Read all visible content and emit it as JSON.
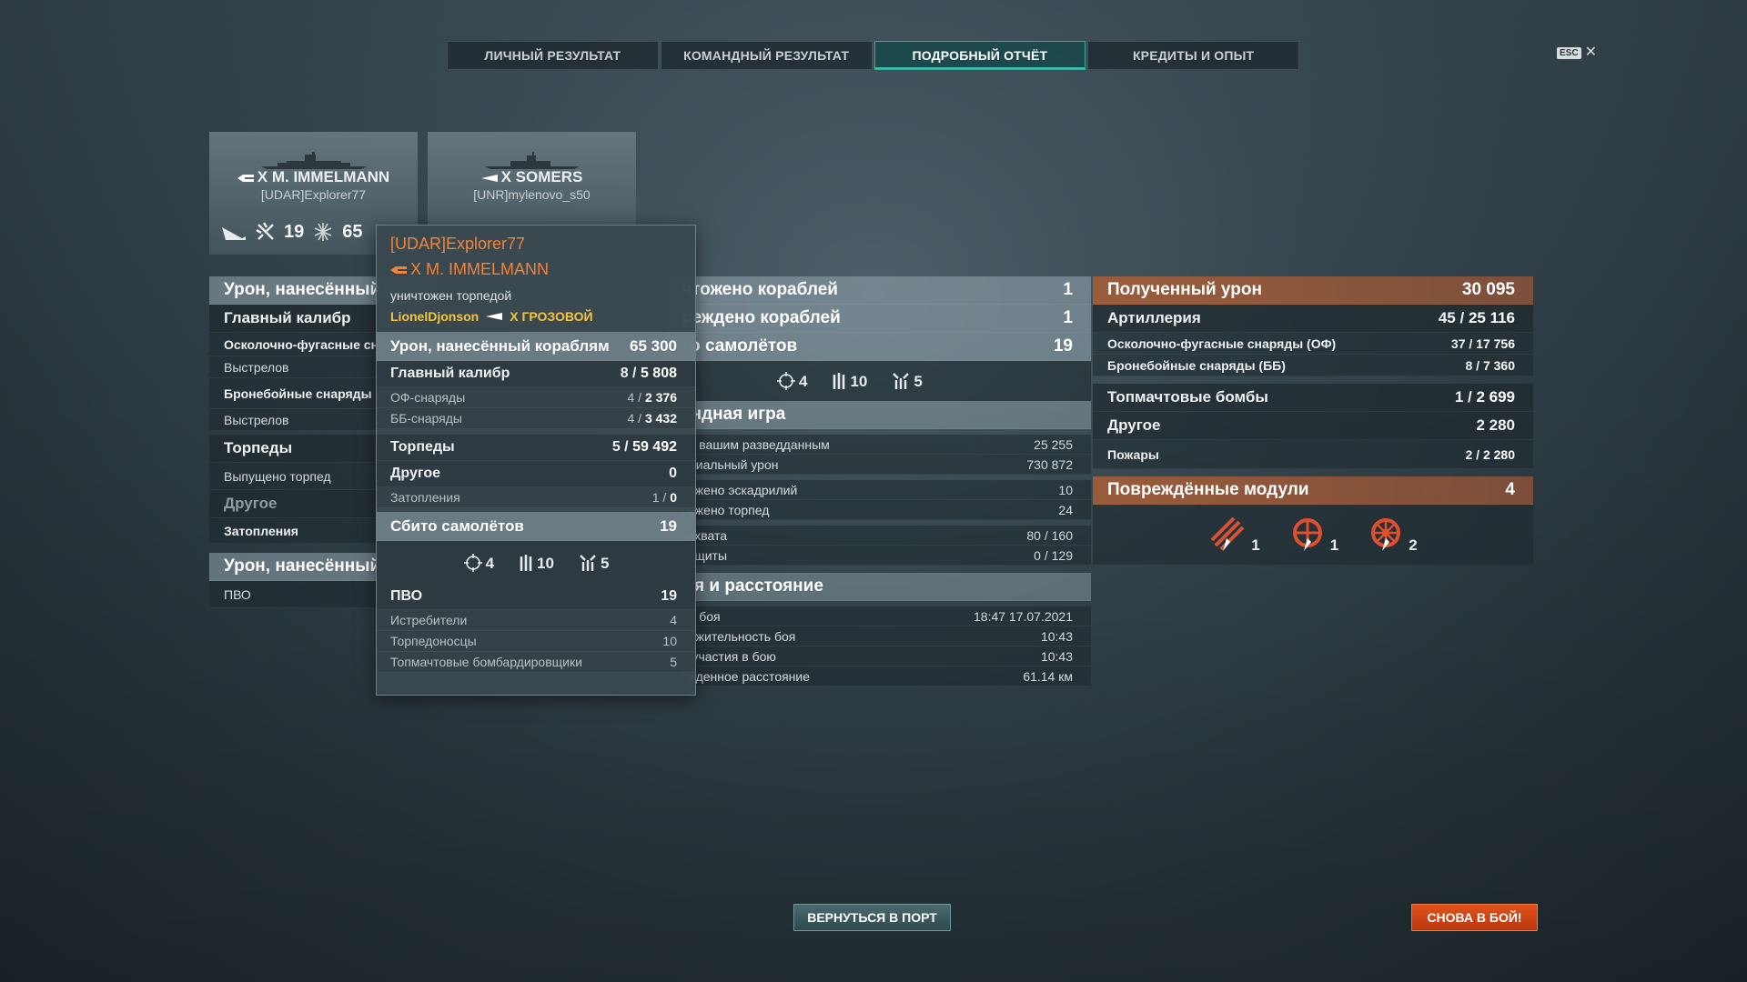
{
  "tabs": [
    "ЛИЧНЫЙ РЕЗУЛЬТАТ",
    "КОМАНДНЫЙ РЕЗУЛЬТАТ",
    "ПОДРОБНЫЙ ОТЧЁТ",
    "КРЕДИТЫ И ОПЫТ"
  ],
  "active_tab": "ПОДРОБНЫЙ ОТЧЁТ",
  "esc": {
    "key": "ESC",
    "close": "✕"
  },
  "cards": [
    {
      "ship": "X M. IMMELMANN",
      "player": "[UDAR]Explorer77",
      "planes": "19",
      "hits": "65"
    },
    {
      "ship": "X SOMERS",
      "player": "[UNR]mylenovo_s50"
    }
  ],
  "left": {
    "header": "Урон, нанесённый",
    "main_caliber": "Главный калибр",
    "he": "Осколочно-фугасные сна",
    "shots1": "Выстрелов",
    "ap": "Бронебойные снаряды (Б",
    "shots2": "Выстрелов",
    "torpedoes": "Торпеды",
    "torp_launched": "Выпущено торпед",
    "other": "Другое",
    "flooding": "Затопления",
    "header2": "Урон, нанесённый",
    "aa": "ПВО"
  },
  "middle": {
    "destroyed": "чтожено кораблей",
    "destroyed_val": "1",
    "damaged": "реждено кораблей",
    "damaged_val": "1",
    "planes": "то самолётов",
    "planes_val": "19",
    "icon_fighters": "4",
    "icon_torp": "10",
    "icon_bomb": "5",
    "team_header": "андная игра",
    "team_rows": [
      {
        "label": "по вашим разведданным",
        "value": "25 255"
      },
      {
        "label": "нциальный урон",
        "value": "730 872"
      },
      {
        "label": "ружено эскадрилий",
        "value": "10"
      },
      {
        "label": "ружено торпед",
        "value": "24"
      },
      {
        "label": "захвата",
        "value": "80 / 160"
      },
      {
        "label": "защиты",
        "value": "0 / 129"
      }
    ],
    "time_header": "мя и расстояние",
    "time_rows": [
      {
        "label": "по боя",
        "value": "18:47  17.07.2021"
      },
      {
        "label": "олжительность боя",
        "value": "10:43"
      },
      {
        "label": "я участия в бою",
        "value": "10:43"
      },
      {
        "label": "ойденное расстояние",
        "value": "61.14 км"
      }
    ]
  },
  "right": {
    "received": "Полученный урон",
    "received_val": "30 095",
    "artillery": "Артиллерия",
    "artillery_a": "45",
    "artillery_b": "25 116",
    "he": "Осколочно-фугасные снаряды (ОФ)",
    "he_a": "37",
    "he_b": "17 756",
    "ap": "Бронебойные снаряды (ББ)",
    "ap_a": "8",
    "ap_b": "7 360",
    "bombs": "Топмачтовые бомбы",
    "bombs_a": "1",
    "bombs_b": "2 699",
    "other": "Другое",
    "other_val": "2 280",
    "fires": "Пожары",
    "fires_a": "2",
    "fires_b": "2 280",
    "modules": "Повреждённые модули",
    "modules_val": "4",
    "mod1": "1",
    "mod2": "1",
    "mod3": "2"
  },
  "tooltip": {
    "player": "[UDAR]Explorer77",
    "ship": "X M. IMMELMANN",
    "reason": "уничтожен торпедой",
    "killer": "LionelDjonson",
    "killer_ship": "X ГРОЗОВОЙ",
    "dmg": "Урон, нанесённый кораблям",
    "dmg_val": "65 300",
    "mc": "Главный калибр",
    "mc_a": "8",
    "mc_b": "5 808",
    "of": "ОФ-снаряды",
    "of_a": "4",
    "of_b": "2 376",
    "bb": "ББ-снаряды",
    "bb_a": "4",
    "bb_b": "3 432",
    "torp": "Торпеды",
    "torp_a": "5",
    "torp_b": "59 492",
    "other": "Другое",
    "other_val": "0",
    "flood": "Затопления",
    "flood_a": "1",
    "flood_b": "0",
    "planes": "Сбито самолётов",
    "planes_val": "19",
    "i_fighters": "4",
    "i_torp": "10",
    "i_bomb": "5",
    "aa": "ПВО",
    "aa_val": "19",
    "fighters": "Истребители",
    "fighters_val": "4",
    "torp_bombers": "Торпедоносцы",
    "torp_bombers_val": "10",
    "tm_bombers": "Топмачтовые бомбардировщики",
    "tm_bombers_val": "5"
  },
  "buttons": {
    "port": "ВЕРНУТЬСЯ В ПОРТ",
    "battle": "СНОВА В БОЙ!"
  }
}
